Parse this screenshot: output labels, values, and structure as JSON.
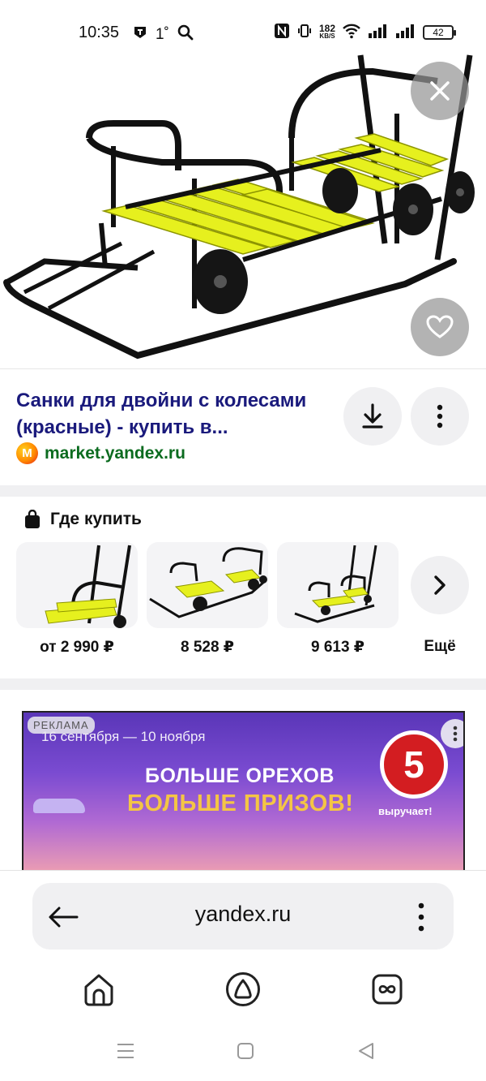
{
  "status_bar": {
    "time": "10:35",
    "temperature": "1˚",
    "net_speed_value": "182",
    "net_speed_unit": "KB/S",
    "battery": "42"
  },
  "result": {
    "title": "Санки для двойни с колесами (красные) - купить в...",
    "source_logo_letter": "М",
    "source_domain": "market.yandex.ru"
  },
  "where_to_buy": {
    "title": "Где купить",
    "offers": [
      {
        "price": "от 2 990 ₽"
      },
      {
        "price": "8 528 ₽"
      },
      {
        "price": "9 613 ₽"
      }
    ],
    "more_label": "Ещё"
  },
  "ad": {
    "badge": "РЕКЛАМА",
    "dates": "16 сентября — 10 ноября",
    "headline1": "БОЛЬШЕ ОРЕХОВ",
    "headline2": "БОЛЬШЕ ПРИЗОВ!",
    "logo_text": "5",
    "slogan": "выручает!"
  },
  "address_bar": {
    "url": "yandex.ru"
  },
  "icons": {
    "close": "close-icon",
    "favorite": "heart-icon",
    "download": "download-icon",
    "more": "more-vertical-icon",
    "bag": "shopping-bag-icon",
    "next": "chevron-right-icon",
    "back": "arrow-left-icon",
    "home": "home-icon",
    "alice": "alice-icon",
    "tabs": "tabs-icon"
  },
  "colors": {
    "title_link": "#1a1a7c",
    "source_green": "#0b6b1f",
    "ad_logo_red": "#d31d21",
    "ad_gold": "#f4c545"
  }
}
